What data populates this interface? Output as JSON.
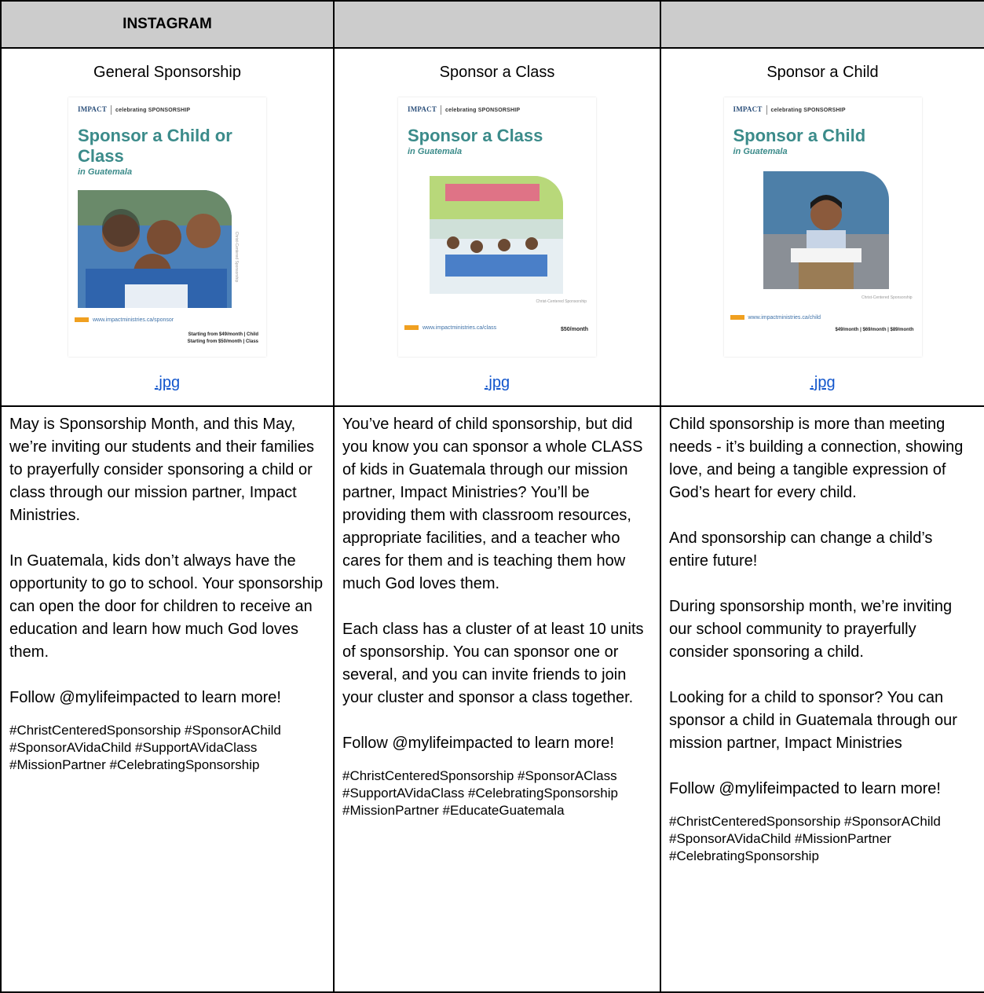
{
  "header": {
    "title": "INSTAGRAM",
    "col2": "",
    "col3": ""
  },
  "columns": [
    {
      "title": "General Sponsorship",
      "poster": {
        "logo": "IMPACT",
        "logo_sub": "MINISTRIES",
        "tag": "celebrating SPONSORSHIP",
        "headline": "Sponsor a Child or Class",
        "subline": "in Guatemala",
        "url": "www.impactministries.ca/sponsor",
        "price_line1": "Starting from $49/month | Child",
        "price_line2": "Starting from $50/month | Class",
        "credit": "Christ-Centered Sponsorship"
      },
      "link": ".jpg",
      "paragraphs": [
        "May is Sponsorship Month, and this May, we’re inviting our students and their families to prayerfully consider sponsoring a child or class through our mission partner, Impact Ministries.",
        "In Guatemala, kids don’t always have the opportunity to go to school. Your sponsorship can open the door for children to receive an education and learn how much God loves them.",
        "Follow @mylifeimpacted to learn more!"
      ],
      "hashtags": "#ChristCenteredSponsorship #SponsorAChild #SponsorAVidaChild #SupportAVidaClass #MissionPartner #CelebratingSponsorship"
    },
    {
      "title": "Sponsor a Class",
      "poster": {
        "logo": "IMPACT",
        "logo_sub": "MINISTRIES",
        "tag": "celebrating SPONSORSHIP",
        "headline": "Sponsor a Class",
        "subline": "in Guatemala",
        "url": "www.impactministries.ca/class",
        "price_line1": "$50/month",
        "price_line2": "",
        "credit": "Christ-Centered Sponsorship"
      },
      "link": ".jpg",
      "paragraphs": [
        "You’ve heard of child sponsorship, but did you know you can sponsor a whole CLASS of kids in Guatemala through our mission partner, Impact Ministries? You’ll be providing them with classroom resources, appropriate facilities, and a teacher who cares for them and is teaching them how much God loves them.",
        "Each class has a cluster of at least 10 units of sponsorship. You can sponsor one or several, and you can invite friends to join your cluster and sponsor a class together.",
        "Follow @mylifeimpacted to learn more!"
      ],
      "hashtags": "#ChristCenteredSponsorship #SponsorAClass #SupportAVidaClass #CelebratingSponsorship #MissionPartner #EducateGuatemala"
    },
    {
      "title": "Sponsor a Child",
      "poster": {
        "logo": "IMPACT",
        "logo_sub": "MINISTRIES",
        "tag": "celebrating SPONSORSHIP",
        "headline": "Sponsor a Child",
        "subline": "in Guatemala",
        "url": "www.impactministries.ca/child",
        "price_line1": "$49/month | $69/month | $89/month",
        "price_line2": "",
        "credit": "Christ-Centered Sponsorship"
      },
      "link": ".jpg",
      "paragraphs": [
        "Child sponsorship is more than meeting needs - it’s building a connection, showing love, and being a tangible expression of God’s heart for every child.",
        "And sponsorship can change a child’s entire future!",
        "During sponsorship month, we’re inviting our school community to prayerfully consider sponsoring a child.",
        "Looking for a child to sponsor? You can sponsor a child in Guatemala through our mission partner, Impact Ministries",
        "Follow @mylifeimpacted to learn more!"
      ],
      "hashtags": "#ChristCenteredSponsorship #SponsorAChild #SponsorAVidaChild #MissionPartner #CelebratingSponsorship"
    }
  ]
}
